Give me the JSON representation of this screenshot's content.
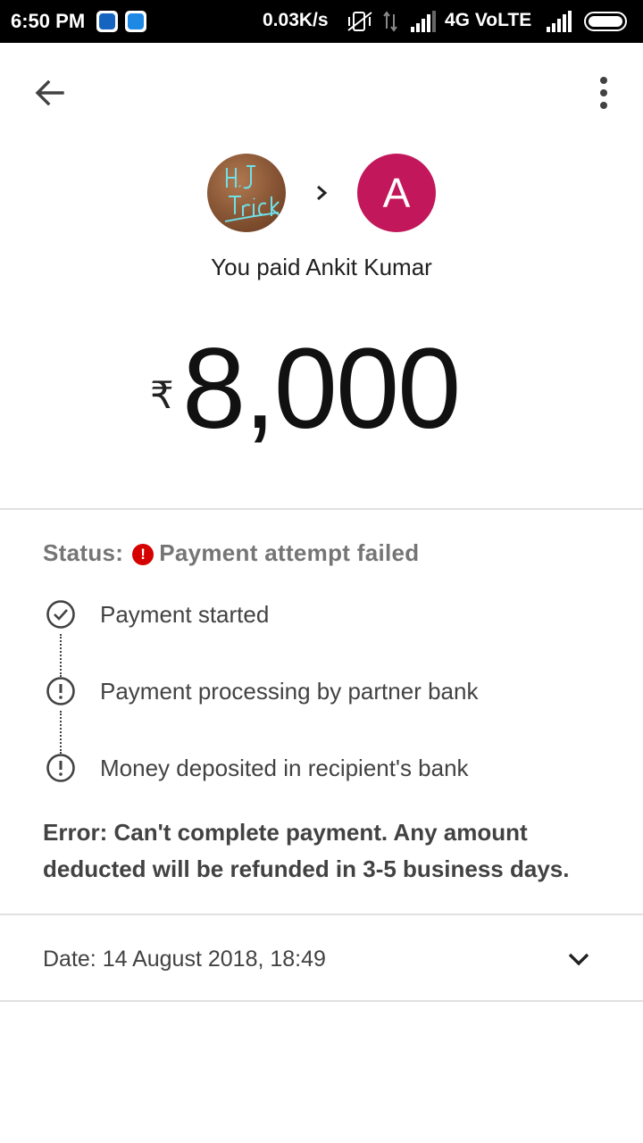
{
  "status_bar": {
    "time": "6:50 PM",
    "speed": "0.03K/s",
    "network": "4G VoLTE"
  },
  "header": {
    "back_icon": "arrow-left-icon",
    "menu_icon": "more-vert-icon"
  },
  "payer": {
    "avatar_caption": "H.J Trick"
  },
  "recipient": {
    "initial": "A",
    "color": "#c2185b"
  },
  "summary": {
    "paid_text": "You paid Ankit Kumar",
    "currency_symbol": "₹",
    "amount": "8,000"
  },
  "status": {
    "label": "Status:",
    "icon": "!",
    "value": "Payment attempt failed",
    "error_color": "#d50000"
  },
  "steps": [
    {
      "label": "Payment started",
      "icon": "check-circle-icon"
    },
    {
      "label": "Payment processing by partner bank",
      "icon": "alert-circle-icon"
    },
    {
      "label": "Money deposited in recipient's bank",
      "icon": "alert-circle-icon"
    }
  ],
  "error_message": "Error: Can't complete payment. Any amount deducted will be refunded in 3-5 business days.",
  "details": {
    "date_text": "Date: 14 August 2018, 18:49",
    "expand_icon": "chevron-down-icon"
  }
}
